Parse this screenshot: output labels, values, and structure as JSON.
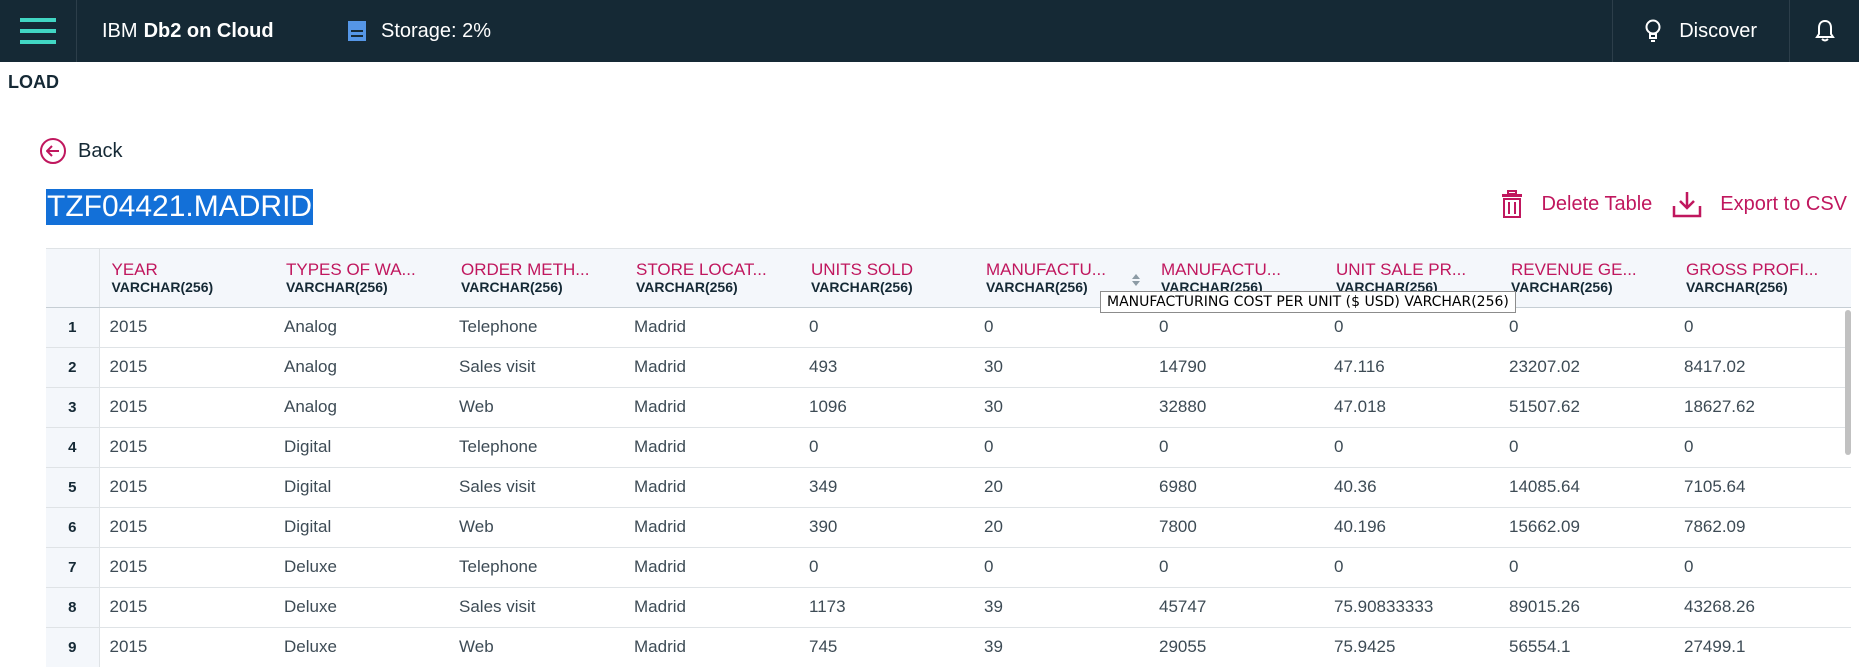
{
  "header": {
    "brand_prefix": "IBM",
    "brand_name": "Db2 on Cloud",
    "storage_label": "Storage: 2%",
    "discover_label": "Discover"
  },
  "page_title": "LOAD",
  "back_label": "Back",
  "table_name": "TZF04421.MADRID",
  "actions": {
    "delete_label": "Delete Table",
    "export_label": "Export to CSV"
  },
  "columns": [
    {
      "name": "YEAR",
      "type": "VARCHAR(256)"
    },
    {
      "name": "TYPES OF WA...",
      "type": "VARCHAR(256)"
    },
    {
      "name": "ORDER METH...",
      "type": "VARCHAR(256)"
    },
    {
      "name": "STORE LOCAT...",
      "type": "VARCHAR(256)"
    },
    {
      "name": "UNITS SOLD",
      "type": "VARCHAR(256)"
    },
    {
      "name": "MANUFACTU...",
      "type": "VARCHAR(256)"
    },
    {
      "name": "MANUFACTU...",
      "type": "VARCHAR(256)"
    },
    {
      "name": "UNIT SALE PR...",
      "type": "VARCHAR(256)"
    },
    {
      "name": "REVENUE GE...",
      "type": "VARCHAR(256)"
    },
    {
      "name": "GROSS PROFI...",
      "type": "VARCHAR(256)"
    }
  ],
  "rows": [
    [
      "1",
      "2015",
      "Analog",
      "Telephone",
      "Madrid",
      "0",
      "0",
      "0",
      "0",
      "0",
      "0"
    ],
    [
      "2",
      "2015",
      "Analog",
      "Sales visit",
      "Madrid",
      "493",
      "30",
      "14790",
      "47.116",
      "23207.02",
      "8417.02"
    ],
    [
      "3",
      "2015",
      "Analog",
      "Web",
      "Madrid",
      "1096",
      "30",
      "32880",
      "47.018",
      "51507.62",
      "18627.62"
    ],
    [
      "4",
      "2015",
      "Digital",
      "Telephone",
      "Madrid",
      "0",
      "0",
      "0",
      "0",
      "0",
      "0"
    ],
    [
      "5",
      "2015",
      "Digital",
      "Sales visit",
      "Madrid",
      "349",
      "20",
      "6980",
      "40.36",
      "14085.64",
      "7105.64"
    ],
    [
      "6",
      "2015",
      "Digital",
      "Web",
      "Madrid",
      "390",
      "20",
      "7800",
      "40.196",
      "15662.09",
      "7862.09"
    ],
    [
      "7",
      "2015",
      "Deluxe",
      "Telephone",
      "Madrid",
      "0",
      "0",
      "0",
      "0",
      "0",
      "0"
    ],
    [
      "8",
      "2015",
      "Deluxe",
      "Sales visit",
      "Madrid",
      "1173",
      "39",
      "45747",
      "75.90833333",
      "89015.26",
      "43268.26"
    ],
    [
      "9",
      "2015",
      "Deluxe",
      "Web",
      "Madrid",
      "745",
      "39",
      "29055",
      "75.9425",
      "56554.1",
      "27499.1"
    ]
  ],
  "tooltip": "MANUFACTURING COST PER UNIT ($ USD) VARCHAR(256)",
  "colors": {
    "topbar": "#152935",
    "accent": "#c0175e",
    "selection": "#1370d8",
    "menu_icon": "#41d6c3",
    "storage_icon": "#5596e6"
  }
}
